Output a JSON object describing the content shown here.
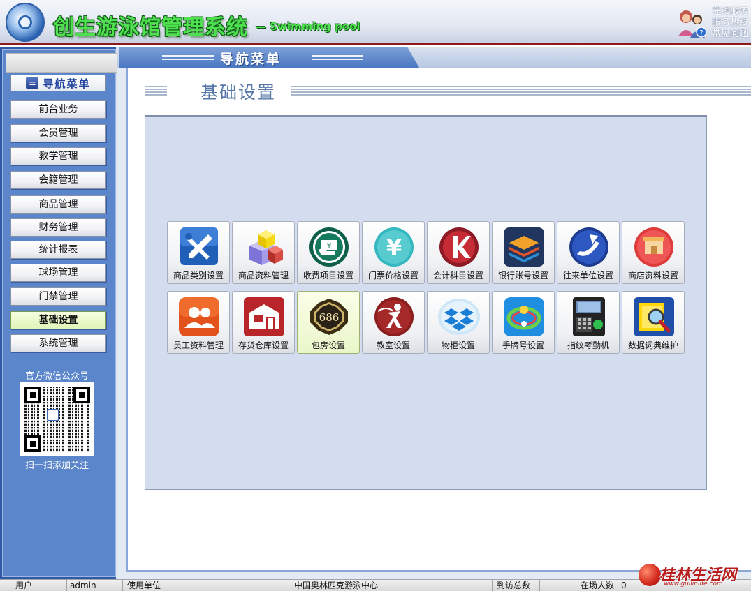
{
  "header": {
    "app_title": "创生游泳馆管理系统",
    "app_subtitle": "— Swimming pool",
    "service_links": [
      "在线服务",
      "服务热线",
      "常见问题"
    ]
  },
  "sidebar": {
    "nav_header": "导航菜单",
    "items": [
      {
        "label": "前台业务",
        "active": false
      },
      {
        "label": "会员管理",
        "active": false
      },
      {
        "label": "教学管理",
        "active": false
      },
      {
        "label": "会籍管理",
        "active": false
      },
      {
        "label": "商品管理",
        "active": false
      },
      {
        "label": "财务管理",
        "active": false
      },
      {
        "label": "统计报表",
        "active": false
      },
      {
        "label": "球场管理",
        "active": false
      },
      {
        "label": "门禁管理",
        "active": false
      },
      {
        "label": "基础设置",
        "active": true
      },
      {
        "label": "系统管理",
        "active": false
      }
    ],
    "wechat_title": "官方微信公众号",
    "wechat_hint": "扫一扫添加关注"
  },
  "main": {
    "tab_title": "导航菜单",
    "section_title": "基础设置",
    "tiles": [
      {
        "label": "商品类别设置",
        "icon": "wrench-screwdriver-icon"
      },
      {
        "label": "商品资料管理",
        "icon": "boxes-icon"
      },
      {
        "label": "收费项目设置",
        "icon": "cash-hand-icon"
      },
      {
        "label": "门票价格设置",
        "icon": "yen-icon"
      },
      {
        "label": "会计科目设置",
        "icon": "accounting-icon"
      },
      {
        "label": "银行账号设置",
        "icon": "layers-icon"
      },
      {
        "label": "往来单位设置",
        "icon": "partner-logo-icon"
      },
      {
        "label": "商店资料设置",
        "icon": "shop-icon"
      },
      {
        "label": "员工资料管理",
        "icon": "users-icon"
      },
      {
        "label": "存货仓库设置",
        "icon": "warehouse-icon"
      },
      {
        "label": "包房设置",
        "icon": "room-686-icon",
        "active": true
      },
      {
        "label": "教室设置",
        "icon": "classroom-icon"
      },
      {
        "label": "物柜设置",
        "icon": "dropbox-icon"
      },
      {
        "label": "手牌号设置",
        "icon": "wristband-icon"
      },
      {
        "label": "指纹考勤机",
        "icon": "fingerprint-device-icon"
      },
      {
        "label": "数据词典维护",
        "icon": "dictionary-search-icon"
      }
    ]
  },
  "statusbar": {
    "user_label": "用户",
    "user_value": "admin",
    "org_label": "使用单位",
    "org_value": "中国奥林匹克游泳中心",
    "visits_label": "到访总数",
    "visits_value": "",
    "present_label": "在场人数",
    "present_value": "0"
  },
  "watermark": {
    "text": "桂林生活网",
    "url": "www.guilinlife.com"
  },
  "colors": {
    "sidebar_bg": "#5c86cb",
    "panel_bg": "#d4ddf0",
    "title_green": "#4fe04f",
    "header_rule": "#8e1b1b"
  }
}
